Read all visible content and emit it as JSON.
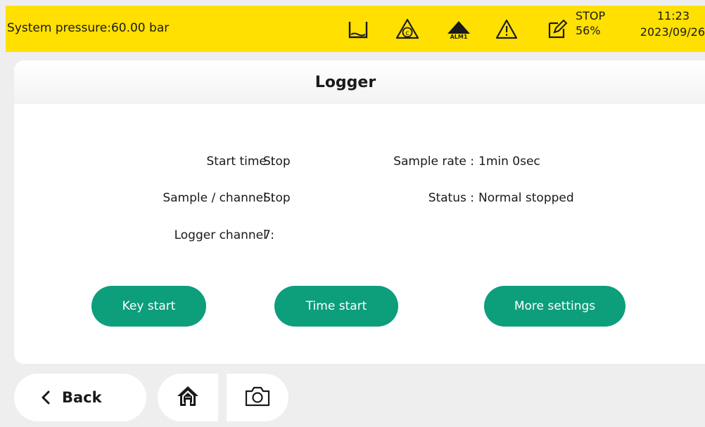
{
  "status_bar": {
    "pressure_text": "System pressure:60.00 bar",
    "icons": [
      "bath-icon",
      "circulation-c-icon",
      "alarm-alm1-icon",
      "warning-icon",
      "edit-icon"
    ],
    "alarm_label": "ALM1",
    "stop_label": "STOP",
    "percent": "56%",
    "time": "11:23",
    "date": "2023/09/26",
    "colors": {
      "background": "#ffe000"
    }
  },
  "panel": {
    "title": "Logger",
    "fields": {
      "start_time": {
        "label": "Start time :",
        "value": "Stop"
      },
      "sample_rate": {
        "label": "Sample rate :",
        "value": "1min 0sec"
      },
      "sample_channel": {
        "label": "Sample / channel :",
        "value": "Stop"
      },
      "status": {
        "label": "Status :",
        "value": "Normal stopped"
      },
      "logger_channel": {
        "label": "Logger channel :",
        "value": "7"
      }
    },
    "buttons": {
      "key_start": "Key start",
      "time_start": "Time start",
      "more_settings": "More settings"
    },
    "colors": {
      "accent": "#0d9e7c"
    }
  },
  "nav": {
    "back_label": "Back",
    "icons": [
      "chevron-left-icon",
      "home-icon",
      "camera-icon"
    ]
  }
}
